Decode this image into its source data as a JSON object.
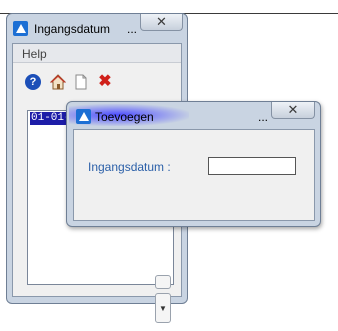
{
  "back_window": {
    "title": "Ingangsdatum",
    "title_overflow": "...",
    "close_glyph": "✕",
    "menu": {
      "help_label": "Help"
    },
    "toolbar": {
      "help_icon_glyph": "?",
      "delete_icon_glyph": "✖"
    },
    "list": {
      "items": [
        "01-01-"
      ]
    },
    "scroll_down_glyph": "▼"
  },
  "dialog": {
    "title": "Toevoegen",
    "title_overflow": "...",
    "close_glyph": "✕",
    "field_label": "Ingangsdatum :",
    "field_value": ""
  },
  "icons": [
    "app-icon",
    "help-icon",
    "home-icon",
    "new-document-icon",
    "delete-icon",
    "close-icon",
    "scroll-down-icon"
  ],
  "colors": {
    "title_bar": "#c9d4e2",
    "selection": "#1d1da8",
    "label_text": "#2a5fa8",
    "delete_icon": "#d0201a",
    "app_icon": "#1c6fd4"
  }
}
